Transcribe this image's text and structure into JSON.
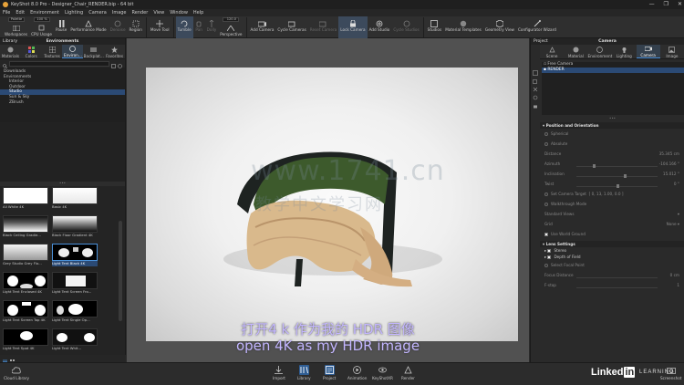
{
  "window": {
    "title": "KeyShot 8.0 Pro  -  Designer_Chair_RENDER.bip  -  64 bit",
    "controls": [
      "—",
      "❐",
      "✕"
    ]
  },
  "menu": [
    "File",
    "Edit",
    "Environment",
    "Lighting",
    "Camera",
    "Image",
    "Render",
    "View",
    "Window",
    "Help"
  ],
  "toolbar": {
    "workspace_value": "Palette",
    "cpu_value": "100 %",
    "items": [
      {
        "label": "Workspaces",
        "icon": "workspaces-icon"
      },
      {
        "label": "CPU Usage",
        "icon": "cpu-icon"
      },
      {
        "label": "Pause",
        "icon": "pause-icon"
      },
      {
        "label": "Performance Mode",
        "icon": "performance-icon"
      },
      {
        "label": "Denoise",
        "icon": "denoise-icon"
      },
      {
        "label": "Region",
        "icon": "region-icon"
      },
      {
        "label": "Move Tool",
        "icon": "move-icon"
      },
      {
        "label": "Tumble",
        "icon": "tumble-icon"
      },
      {
        "label": "Pan",
        "icon": "pan-icon"
      },
      {
        "label": "Dolly",
        "icon": "dolly-icon"
      },
      {
        "label": "Perspective",
        "icon": "perspective-icon"
      },
      {
        "label": "Add Camera",
        "icon": "add-camera-icon"
      },
      {
        "label": "Cycle Cameras",
        "icon": "cycle-cameras-icon"
      },
      {
        "label": "Reset Camera",
        "icon": "reset-camera-icon"
      },
      {
        "label": "Lock Camera",
        "icon": "lock-camera-icon"
      },
      {
        "label": "Add Studio",
        "icon": "add-studio-icon"
      },
      {
        "label": "Cycle Studios",
        "icon": "cycle-studios-icon"
      },
      {
        "label": "Studios",
        "icon": "studios-icon"
      },
      {
        "label": "Material Templates",
        "icon": "material-templates-icon"
      },
      {
        "label": "Geometry View",
        "icon": "geometry-view-icon"
      },
      {
        "label": "Configurator Wizard",
        "icon": "configurator-icon"
      }
    ],
    "fov_value": "120.0"
  },
  "library": {
    "panel_title": "Library",
    "center_title": "Environments",
    "tabs": [
      "Materials",
      "Colors",
      "Textures",
      "Environ...",
      "Backplat...",
      "Favorites"
    ],
    "active_tab": "Environ...",
    "tree": [
      "Downloads",
      "Environments",
      "Interior",
      "Outdoor",
      "Studio",
      "Sun & Sky",
      "ZBrush"
    ],
    "selected_tree": "Studio",
    "thumbnails": [
      {
        "label": "All White 4K",
        "style": "white"
      },
      {
        "label": "Basic 4K",
        "style": "white"
      },
      {
        "label": "Black Ceiling Gradie...",
        "style": "blackceiling"
      },
      {
        "label": "Black Floor Gradient 4K",
        "style": "blackfloor"
      },
      {
        "label": "Grey Studio Grey Flo...",
        "style": "grey"
      },
      {
        "label": "Light Tent Black 4K",
        "style": "tentblack"
      },
      {
        "label": "Light Tent Enclosed 4K",
        "style": "enclosed"
      },
      {
        "label": "Light Tent Screen Fro...",
        "style": "screen"
      },
      {
        "label": "Light Tent Screen Top 4K",
        "style": "screentop"
      },
      {
        "label": "Light Tent Single Op...",
        "style": "single"
      },
      {
        "label": "Light Tent Spot 4K",
        "style": "spot"
      },
      {
        "label": "Light Tent Whit...",
        "style": "tentwhite"
      }
    ],
    "selected_thumb": "Light Tent Black 4K"
  },
  "viewport": {
    "watermark": "www.1741.cn",
    "watermark_sub": "教学中文学习网",
    "subtitle_cn": "打开4 k 作为我的 HDR 图像",
    "subtitle_en": "open 4K as my HDR image"
  },
  "project": {
    "panel_title": "Project",
    "center_title": "Camera",
    "tabs": [
      "Scene",
      "Material",
      "Environment",
      "Lighting",
      "Camera",
      "Image"
    ],
    "active_tab": "Camera",
    "cameras": [
      "Free Camera",
      "RENDER"
    ],
    "selected_camera": "RENDER",
    "position_section": "Position and Orientation",
    "position_modes": [
      "Spherical",
      "Absolute"
    ],
    "distance_label": "Distance",
    "distance_value": "35.345 cm",
    "azimuth_label": "Azimuth",
    "azimuth_value": "-104.166 °",
    "inclination_label": "Inclination",
    "inclination_value": "15.012 °",
    "twist_label": "Twist",
    "twist_value": "0 °",
    "target_label": "Set Camera Target",
    "target_value": "[ 0, 13, 1.00, 0.0 ]",
    "walkthrough_label": "Walkthrough Mode",
    "standard_views_label": "Standard Views",
    "grid_label": "Grid",
    "grid_value": "None",
    "use_world_label": "Use World Ground",
    "lens_section": "Lens Settings",
    "stereo_label": "Stereo",
    "dof_label": "Depth of Field",
    "focal_point_label": "Select Focal Point",
    "focus_distance_label": "Focus Distance",
    "focus_distance_value": "0 cm",
    "fstop_label": "F-stop",
    "fstop_value": "1"
  },
  "bottombar": {
    "cloud_label": "Cloud Library",
    "items": [
      {
        "label": "Import",
        "icon": "import-icon"
      },
      {
        "label": "Library",
        "icon": "library-icon"
      },
      {
        "label": "Project",
        "icon": "project-icon"
      },
      {
        "label": "Animation",
        "icon": "animation-icon"
      },
      {
        "label": "KeyShotXR",
        "icon": "keyshotxr-icon"
      },
      {
        "label": "Render",
        "icon": "render-icon"
      }
    ],
    "active": [
      "Library",
      "Project"
    ],
    "screenshot_label": "Screenshot",
    "brand": "Linked",
    "brand_in": "in",
    "brand_learning": "LEARNING"
  },
  "colors": {
    "accent": "#2b4a75",
    "chair_seat": "#3d5a2c",
    "wood": "#d9b98c",
    "subtitle": "#c3b6ff"
  }
}
